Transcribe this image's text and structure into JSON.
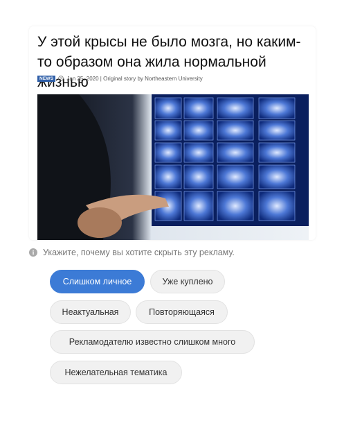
{
  "article": {
    "headline": "У этой крысы не было мозга, но каким-то образом она жила нормальной жизнью",
    "badge": "NEWS",
    "meta": "Jan 25, 2020 | Original story by Northeastern University",
    "image_icon": "brain-scan-photo"
  },
  "feedback": {
    "prompt": "Укажите, почему вы хотите скрыть эту рекламу.",
    "reasons": [
      {
        "label": "Слишком личное",
        "selected": true
      },
      {
        "label": "Уже куплено",
        "selected": false
      },
      {
        "label": "Неактуальная",
        "selected": false
      },
      {
        "label": "Повторяющаяся",
        "selected": false
      },
      {
        "label": "Рекламодателю известно слишком много",
        "selected": false
      },
      {
        "label": "Нежелательная тематика",
        "selected": false
      }
    ]
  },
  "colors": {
    "accent": "#3c7bd6",
    "badge": "#2f5fa8"
  }
}
